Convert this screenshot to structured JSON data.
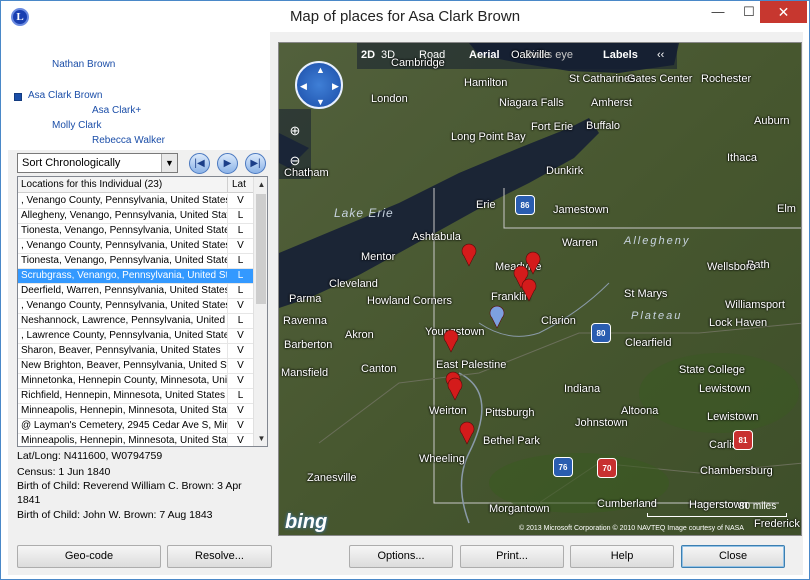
{
  "window": {
    "title": "Map of places for Asa Clark Brown",
    "icon_letter": "L",
    "minimize_glyph": "—",
    "maximize_glyph": "☐",
    "close_glyph": "✕"
  },
  "tree": {
    "items": [
      {
        "label": "Nathan Brown"
      },
      {
        "label": "Asa Clark Brown"
      },
      {
        "label": "Asa Clark+"
      },
      {
        "label": "Molly Clark"
      },
      {
        "label": "Rebecca Walker"
      }
    ]
  },
  "sort": {
    "selected": "Sort Chronologically",
    "arrow_glyph": "▼"
  },
  "nav": {
    "first_glyph": "|◀",
    "play_glyph": "▶",
    "last_glyph": "▶|"
  },
  "locations": {
    "header_location": "Locations for this Individual (23)",
    "header_lat": "Lat",
    "rows": [
      {
        "location": ", Venango County, Pennsylvania, United States",
        "lat": "V"
      },
      {
        "location": "Allegheny, Venango, Pennsylvania, United States",
        "lat": "L"
      },
      {
        "location": "Tionesta, Venango, Pennsylvania, United States",
        "lat": "L"
      },
      {
        "location": ", Venango County, Pennsylvania, United States",
        "lat": "V"
      },
      {
        "location": "Tionesta, Venango, Pennsylvania, United States",
        "lat": "L"
      },
      {
        "location": "Scrubgrass, Venango, Pennsylvania, United States",
        "lat": "L",
        "selected": true
      },
      {
        "location": "Deerfield, Warren, Pennsylvania, United States",
        "lat": "L"
      },
      {
        "location": ", Venango County, Pennsylvania, United States",
        "lat": "V"
      },
      {
        "location": "Neshannock, Lawrence, Pennsylvania, United States",
        "lat": "L"
      },
      {
        "location": ", Lawrence County, Pennsylvania, United States",
        "lat": "V"
      },
      {
        "location": "Sharon, Beaver, Pennsylvania, United States",
        "lat": "V"
      },
      {
        "location": "New Brighton, Beaver, Pennsylvania, United States",
        "lat": "V"
      },
      {
        "location": "Minnetonka, Hennepin County, Minnesota, United States",
        "lat": "V"
      },
      {
        "location": "Richfield, Hennepin, Minnesota, United States",
        "lat": "L"
      },
      {
        "location": "Minneapolis, Hennepin, Minnesota, United States",
        "lat": "V"
      },
      {
        "location": "@ Layman's Cemetery, 2945 Cedar Ave S, Minneapolis",
        "lat": "V"
      },
      {
        "location": "Minneapolis, Hennepin, Minnesota, United States",
        "lat": "V"
      }
    ],
    "scroll_up": "▲",
    "scroll_down": "▼"
  },
  "details": {
    "latlong": "Lat/Long: N411600, W0794759",
    "census": "Census: 1 Jun 1840",
    "birth1_line1": "Birth of Child: Reverend William C. Brown: 3 Apr",
    "birth1_line2": "1841",
    "birth2": "Birth of Child: John W. Brown: 7 Aug 1843"
  },
  "map": {
    "toolbar": {
      "mode_2d": "2D",
      "mode_3d": "3D",
      "road": "Road",
      "aerial": "Aerial",
      "birdseye": "Bird's eye",
      "labels": "Labels",
      "collapse": "‹‹"
    },
    "compass": {
      "n": "▲",
      "s": "▼",
      "e": "▶",
      "w": "◀"
    },
    "zoom_in": "⊕",
    "zoom_out": "⊖",
    "cities": [
      "Hamilton",
      "St Catharines",
      "Gates Center",
      "Rochester",
      "Oakville",
      "Cambridge",
      "London",
      "Niagara Falls",
      "Amherst",
      "Fort Erie",
      "Buffalo",
      "Auburn",
      "Long Point Bay",
      "Dunkirk",
      "Ithaca",
      "Chatham",
      "Erie",
      "Jamestown",
      "Elm",
      "Ashtabula",
      "Warren",
      "Bath",
      "Mentor",
      "Meadville",
      "Wellsboro",
      "Cleveland",
      "Franklin",
      "St Marys",
      "Parma",
      "Howland Corners",
      "Williamsport",
      "Ravenna",
      "Clarion",
      "Lock Haven",
      "Akron",
      "Youngstown",
      "Clearfield",
      "Barberton",
      "Canton",
      "East Palestine",
      "State College",
      "Mansfield",
      "Indiana",
      "Lewistown",
      "Altoona",
      "Weirton",
      "Pittsburgh",
      "Johnstown",
      "Lewistown",
      "Bethel Park",
      "Carlisle",
      "Wheeling",
      "Chambersburg",
      "Zanesville",
      "Morgantown",
      "Cumberland",
      "Hagerstown",
      "Frederick"
    ],
    "lake_label": "Lake Erie",
    "region_label": "Allegheny",
    "plateau_label": "Plateau",
    "logo": "bing",
    "copyright": "© 2013 Microsoft Corporation   © 2010 NAVTEQ   Image courtesy of NASA",
    "scale": "80 miles",
    "highways": [
      "86",
      "80",
      "80",
      "76",
      "70",
      "81",
      "83"
    ]
  },
  "buttons": {
    "geocode": "Geo-code",
    "resolve": "Resolve...",
    "options": "Options...",
    "print": "Print...",
    "help": "Help",
    "close": "Close"
  }
}
